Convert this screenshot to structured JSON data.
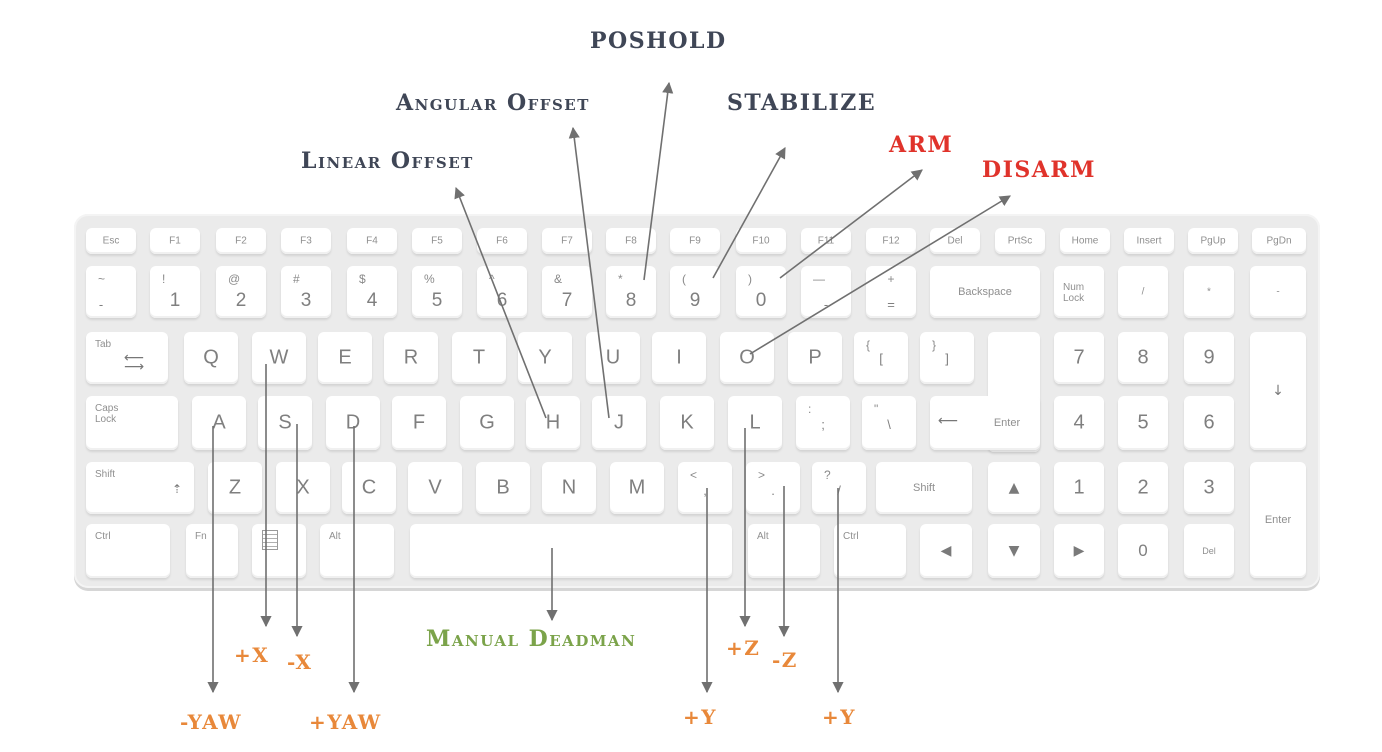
{
  "colors": {
    "mode": "#3f4656",
    "alert": "#e0332b",
    "axis": "#e8883a",
    "deadman": "#7ba34a",
    "arrow": "#707070"
  },
  "labels": {
    "poshold": "POSHOLD",
    "angular_offset": "Angular Offset",
    "stabilize": "STABILIZE",
    "linear_offset": "Linear Offset",
    "arm": "ARM",
    "disarm": "DISARM",
    "manual_deadman": "Manual Deadman",
    "plus_x": "+X",
    "minus_x": "-X",
    "minus_yaw": "-YAW",
    "plus_yaw": "+YAW",
    "plus_z": "+Z",
    "minus_z": "-Z",
    "plus_y_1": "+Y",
    "plus_y_2": "+Y"
  },
  "keyboard": {
    "fn_row": [
      "Esc",
      "F1",
      "F2",
      "F3",
      "F4",
      "F5",
      "F6",
      "F7",
      "F8",
      "F9",
      "F10",
      "F11",
      "F12",
      "Del",
      "PrtSc",
      "Home",
      "Insert",
      "PgUp",
      "PgDn"
    ],
    "num_row": [
      {
        "top": "~",
        "bot": "-"
      },
      {
        "top": "!",
        "bot": "1"
      },
      {
        "top": "@",
        "bot": "2"
      },
      {
        "top": "#",
        "bot": "3"
      },
      {
        "top": "$",
        "bot": "4"
      },
      {
        "top": "%",
        "bot": "5"
      },
      {
        "top": "^",
        "bot": "6"
      },
      {
        "top": "&",
        "bot": "7"
      },
      {
        "top": "*",
        "bot": "8"
      },
      {
        "top": "(",
        "bot": "9"
      },
      {
        "top": ")",
        "bot": "0"
      },
      {
        "top": "—",
        "bot": "-"
      },
      {
        "top": "+",
        "bot": "="
      }
    ],
    "backspace": "Backspace",
    "numlock": "Num Lock",
    "num_slash": "/",
    "num_star": "*",
    "num_minus": "-",
    "tab": "Tab",
    "qrow": [
      "Q",
      "W",
      "E",
      "R",
      "T",
      "Y",
      "U",
      "I",
      "O",
      "P"
    ],
    "lbrace": {
      "top": "{",
      "bot": "["
    },
    "rbrace": {
      "top": "}",
      "bot": "]"
    },
    "capslock": "Caps Lock",
    "arow": [
      "A",
      "S",
      "D",
      "F",
      "G",
      "H",
      "J",
      "K",
      "L"
    ],
    "colon": {
      "top": ":",
      "bot": ";"
    },
    "quote": {
      "top": "\"",
      "bot": "\\"
    },
    "enter": "Enter",
    "shift_l": "Shift",
    "zrow": [
      "Z",
      "X",
      "C",
      "V",
      "B",
      "N",
      "M"
    ],
    "comma": {
      "top": "<",
      "bot": ","
    },
    "period": {
      "top": ">",
      "bot": "."
    },
    "slash": {
      "top": "?",
      "bot": "/"
    },
    "shift_r": "Shift",
    "ctrl_l": "Ctrl",
    "fn": "Fn",
    "alt_l": "Alt",
    "alt_r": "Alt",
    "ctrl_r": "Ctrl",
    "numpad": [
      "7",
      "8",
      "9",
      "4",
      "5",
      "6",
      "1",
      "2",
      "3",
      "0"
    ],
    "num_del": "Del",
    "num_enter": "Enter",
    "num_plus_arrow": "↓",
    "arrow_up": "▲",
    "arrow_down": "▼",
    "arrow_left": "◀",
    "arrow_right": "▶"
  }
}
